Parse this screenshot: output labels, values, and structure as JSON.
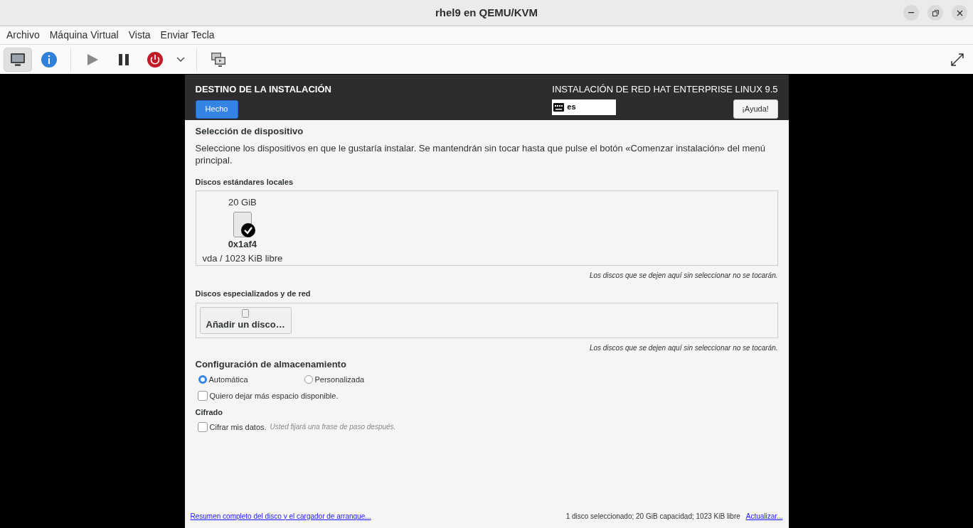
{
  "window": {
    "title": "rhel9 en QEMU/KVM"
  },
  "menu": [
    "Archivo",
    "Máquina Virtual",
    "Vista",
    "Enviar Tecla"
  ],
  "toolbar": [
    {
      "kind": "display",
      "selected": true
    },
    {
      "kind": "info",
      "selected": false
    },
    {
      "kind": "play",
      "selected": false
    },
    {
      "kind": "pause",
      "selected": false
    },
    {
      "kind": "power",
      "selected": false
    },
    {
      "kind": "dropdown",
      "selected": false
    },
    {
      "kind": "consoles",
      "selected": false
    }
  ],
  "installer": {
    "title": "DESTINO DE LA INSTALACIÓN",
    "done_button": "Hecho",
    "product": "INSTALACIÓN DE RED HAT ENTERPRISE LINUX 9.5",
    "keyboard": "es",
    "help_button": "¡Ayuda!",
    "section_title": "Selección de dispositivo",
    "description": "Seleccione los dispositivos en que le gustaría instalar. Se mantendrán sin tocar hasta que pulse el botón «Comenzar instalación» del menú principal.",
    "local_title": "Discos estándares locales",
    "disks": [
      {
        "size": "20 GiB",
        "name": "0x1af4",
        "detail": "vda / 1023 KiB libre",
        "selected": true
      }
    ],
    "local_note": "Los discos que se dejen aquí sin seleccionar no se tocarán.",
    "network_title": "Discos especializados y de red",
    "add_disk_button": "Añadir un disco…",
    "network_note": "Los discos que se dejen aquí sin seleccionar no se tocarán.",
    "storage_title": "Configuración de almacenamiento",
    "storage_options": [
      {
        "label": "Automática",
        "selected": true
      },
      {
        "label": "Personalizada",
        "selected": false
      }
    ],
    "space_checkbox": {
      "label": "Quiero dejar más espacio disponible.",
      "checked": false
    },
    "encryption_title": "Cifrado",
    "encrypt_checkbox": {
      "label": "Cifrar mis datos.",
      "hint": "Usted fijará una frase de paso después.",
      "checked": false
    },
    "summary_link": "Resumen completo del disco y el cargador de arranque...",
    "status": "1 disco seleccionado; 20 GiB capacidad; 1023 KiB libre",
    "refresh_link": "Actualizar..."
  }
}
